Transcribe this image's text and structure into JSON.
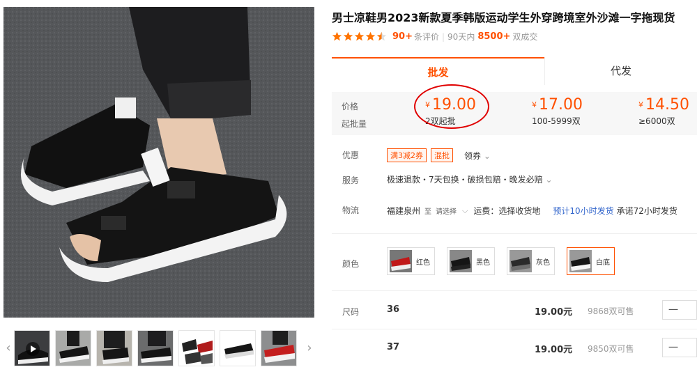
{
  "product": {
    "title": "男士凉鞋男2023新款夏季韩版运动学生外穿跨境室外沙滩一字拖现货",
    "rating_stars": 4.5,
    "review_count": "90+",
    "review_label": "条评价",
    "recent_period": "90天内",
    "deal_count": "8500+",
    "deal_label": "双成交"
  },
  "tabs": [
    {
      "label": "批发",
      "active": true
    },
    {
      "label": "代发",
      "active": false
    }
  ],
  "price_table": {
    "price_label": "价格",
    "moq_label": "起批量",
    "currency": "¥",
    "tiers": [
      {
        "price": "19.00",
        "qty": "2双起批"
      },
      {
        "price": "17.00",
        "qty": "100-5999双"
      },
      {
        "price": "14.50",
        "qty": "≥6000双"
      }
    ]
  },
  "promo": {
    "label": "优惠",
    "tags": [
      "满3减2券",
      "混批"
    ],
    "coupon": "领券"
  },
  "service": {
    "label": "服务",
    "text": "极速退款・7天包换・破损包赔・晚发必赔"
  },
  "logistics": {
    "label": "物流",
    "origin": "福建泉州",
    "to": "至",
    "select": "请选择",
    "fee": "运费：选择收货地",
    "ship_time": "预计10小时发货",
    "promise": "承诺72小时发货"
  },
  "colors": {
    "label": "颜色",
    "options": [
      {
        "name": "红色",
        "selected": false
      },
      {
        "name": "黑色",
        "selected": false
      },
      {
        "name": "灰色",
        "selected": false
      },
      {
        "name": "白底",
        "selected": true
      }
    ]
  },
  "sizes": {
    "label": "尺码",
    "rows": [
      {
        "size": "36",
        "price": "19.00元",
        "stock": "9868双可售"
      },
      {
        "size": "37",
        "price": "19.00元",
        "stock": "9850双可售"
      }
    ],
    "minus": "一"
  },
  "icons": {
    "thumb_prev": "chevron-left-icon",
    "thumb_next": "chevron-right-icon",
    "star": "star-icon",
    "video": "play-video-icon"
  },
  "colors_theme": {
    "accent": "#ff5000",
    "annotation": "#e00000",
    "link": "#3366cc"
  }
}
